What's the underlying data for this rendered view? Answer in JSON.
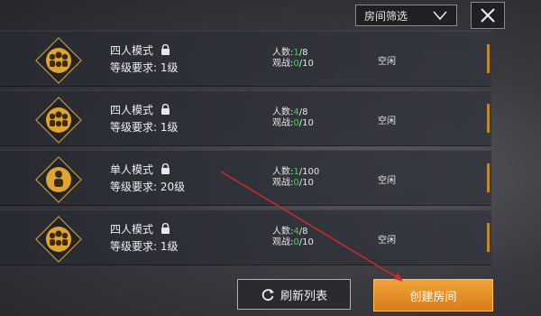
{
  "header": {
    "filter_label": "房间筛选",
    "filter_icon": "chevron-down-icon",
    "close_icon": "close-icon"
  },
  "rooms": [
    {
      "mode": "四人模式",
      "level": "等级要求: 1级",
      "players_label": "人数:",
      "players_count": "1",
      "players_sep": "/",
      "players_max": "8",
      "spectators_label": "观战:",
      "spectators_count": "0",
      "spectators_sep": "/",
      "spectators_max": "10",
      "status": "空闲",
      "badge_icon": "squad-badge-icon"
    },
    {
      "mode": "四人模式",
      "level": "等级要求: 1级",
      "players_label": "人数:",
      "players_count": "4",
      "players_sep": "/",
      "players_max": "8",
      "spectators_label": "观战:",
      "spectators_count": "0",
      "spectators_sep": "/",
      "spectators_max": "10",
      "status": "空闲",
      "badge_icon": "squad-badge-icon"
    },
    {
      "mode": "单人模式",
      "level": "等级要求: 20级",
      "players_label": "人数:",
      "players_count": "1",
      "players_sep": "/",
      "players_max": "100",
      "spectators_label": "观战:",
      "spectators_count": "0",
      "spectators_sep": "/",
      "spectators_max": "10",
      "status": "空闲",
      "badge_icon": "solo-badge-icon"
    },
    {
      "mode": "四人模式",
      "level": "等级要求: 1级",
      "players_label": "人数:",
      "players_count": "4",
      "players_sep": "/",
      "players_max": "8",
      "spectators_label": "观战:",
      "spectators_count": "0",
      "spectators_sep": "/",
      "spectators_max": "10",
      "status": "空闲",
      "badge_icon": "squad-badge-icon"
    }
  ],
  "footer": {
    "refresh_label": "刷新列表",
    "create_label": "创建房间"
  },
  "colors": {
    "accent_orange": "#e8922a",
    "count_green": "#58c26a",
    "badge_gold": "#d9a12a",
    "annotation_red": "#d12a2a"
  }
}
